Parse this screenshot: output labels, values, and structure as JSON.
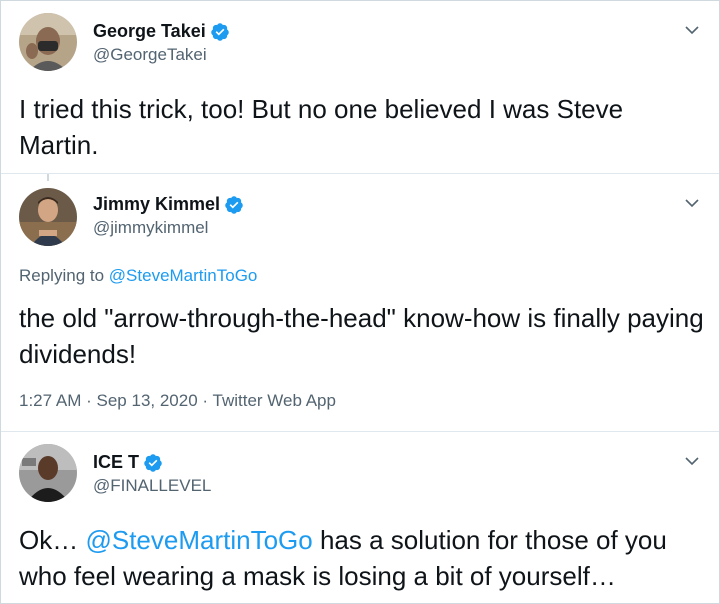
{
  "tweets": [
    {
      "name": "George Takei",
      "handle": "@GeorgeTakei",
      "text": "I tried this trick, too! But no one believed I was Steve Martin."
    },
    {
      "name": "Jimmy Kimmel",
      "handle": "@jimmykimmel",
      "replying_prefix": "Replying to",
      "replying_to": "@SteveMartinToGo",
      "text": "the old \"arrow-through-the-head\" know-how is finally paying dividends!",
      "time": "1:27 AM",
      "date": "Sep 13, 2020",
      "source": "Twitter Web App",
      "dot": "·"
    },
    {
      "name": "ICE T",
      "handle": "@FINALLEVEL",
      "text_prefix": "Ok… ",
      "mention": "@SteveMartinToGo",
      "text_suffix": " has a solution for those of you who feel wearing a mask is losing a bit of yourself…"
    }
  ],
  "colors": {
    "verified": "#1d9bf0",
    "link": "#1d9bf0",
    "secondary_text": "#536471",
    "divider": "#e1e8ed"
  },
  "icons": {
    "verified": "verified-badge-icon",
    "menu": "chevron-down-icon"
  }
}
